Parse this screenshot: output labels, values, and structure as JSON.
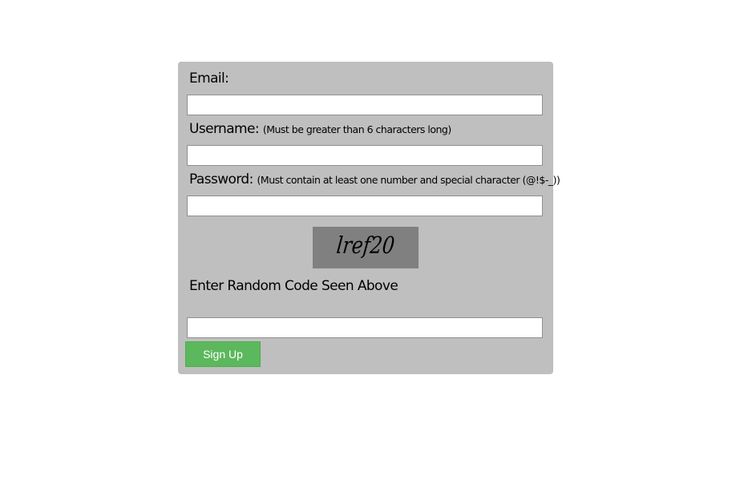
{
  "form": {
    "email_label": "Email:",
    "username_label": "Username:",
    "username_hint": "(Must be greater than 6 characters long)",
    "password_label": "Password:",
    "password_hint": "(Must contain at least one number and special character (@!$-_))",
    "captcha_text": "lref20",
    "captcha_label": "Enter Random Code Seen Above",
    "email_value": "",
    "username_value": "",
    "password_value": "",
    "captcha_value": "",
    "submit_label": "Sign Up"
  },
  "colors": {
    "panel": "#bfbfbf",
    "captcha_bg": "#808080",
    "button": "#5cb85c"
  }
}
